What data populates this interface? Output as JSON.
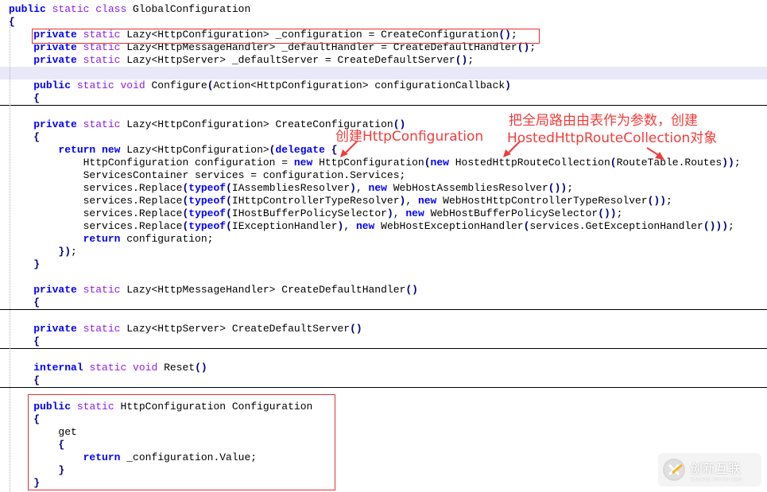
{
  "code": {
    "lines": [
      {
        "indent": "",
        "tokens": [
          {
            "t": "kb",
            "v": "public"
          },
          {
            "t": "",
            "v": " "
          },
          {
            "t": "kp",
            "v": "static class"
          },
          {
            "t": "",
            "v": " GlobalConfiguration"
          }
        ]
      },
      {
        "indent": "",
        "tokens": [
          {
            "t": "pn",
            "v": "{"
          }
        ]
      },
      {
        "indent": "    ",
        "tokens": [
          {
            "t": "kb",
            "v": "private"
          },
          {
            "t": "",
            "v": " "
          },
          {
            "t": "kp",
            "v": "static"
          },
          {
            "t": "",
            "v": " Lazy<HttpConfiguration> _configuration = CreateConfiguration"
          },
          {
            "t": "pn",
            "v": "()"
          },
          {
            "t": "",
            "v": ";"
          }
        ]
      },
      {
        "indent": "    ",
        "tokens": [
          {
            "t": "kb",
            "v": "private"
          },
          {
            "t": "",
            "v": " "
          },
          {
            "t": "kp",
            "v": "static"
          },
          {
            "t": "",
            "v": " Lazy<HttpMessageHandler> _defaultHandler = CreateDefaultHandler"
          },
          {
            "t": "pn",
            "v": "()"
          },
          {
            "t": "",
            "v": ";"
          }
        ]
      },
      {
        "indent": "    ",
        "tokens": [
          {
            "t": "kb",
            "v": "private"
          },
          {
            "t": "",
            "v": " "
          },
          {
            "t": "kp",
            "v": "static"
          },
          {
            "t": "",
            "v": " Lazy<HttpServer> _defaultServer = CreateDefaultServer"
          },
          {
            "t": "pn",
            "v": "()"
          },
          {
            "t": "",
            "v": ";"
          }
        ]
      },
      {
        "indent": "",
        "tokens": [],
        "hl": true
      },
      {
        "indent": "    ",
        "tokens": [
          {
            "t": "kb",
            "v": "public"
          },
          {
            "t": "",
            "v": " "
          },
          {
            "t": "kp",
            "v": "static void"
          },
          {
            "t": "",
            "v": " Configure"
          },
          {
            "t": "pn",
            "v": "("
          },
          {
            "t": "",
            "v": "Action<HttpConfiguration> configurationCallback"
          },
          {
            "t": "pn",
            "v": ")"
          }
        ]
      },
      {
        "indent": "    ",
        "tokens": [
          {
            "t": "pn",
            "v": "{"
          }
        ],
        "sep": true
      },
      {
        "indent": "",
        "tokens": []
      },
      {
        "indent": "    ",
        "tokens": [
          {
            "t": "kb",
            "v": "private"
          },
          {
            "t": "",
            "v": " "
          },
          {
            "t": "kp",
            "v": "static"
          },
          {
            "t": "",
            "v": " Lazy<HttpConfiguration> CreateConfiguration"
          },
          {
            "t": "pn",
            "v": "()"
          }
        ]
      },
      {
        "indent": "    ",
        "tokens": [
          {
            "t": "pn",
            "v": "{"
          }
        ]
      },
      {
        "indent": "        ",
        "tokens": [
          {
            "t": "kb",
            "v": "return new"
          },
          {
            "t": "",
            "v": " Lazy<HttpConfiguration>"
          },
          {
            "t": "pn",
            "v": "("
          },
          {
            "t": "kb",
            "v": "delegate"
          },
          {
            "t": "",
            "v": " "
          },
          {
            "t": "pn",
            "v": "{"
          }
        ]
      },
      {
        "indent": "            ",
        "tokens": [
          {
            "t": "",
            "v": "HttpConfiguration configuration = "
          },
          {
            "t": "kb",
            "v": "new"
          },
          {
            "t": "",
            "v": " HttpConfiguration"
          },
          {
            "t": "pn",
            "v": "("
          },
          {
            "t": "kb",
            "v": "new"
          },
          {
            "t": "",
            "v": " HostedHttpRouteCollection"
          },
          {
            "t": "pn",
            "v": "("
          },
          {
            "t": "",
            "v": "RouteTable.Routes"
          },
          {
            "t": "pn",
            "v": "))"
          },
          {
            "t": "",
            "v": ";"
          }
        ]
      },
      {
        "indent": "            ",
        "tokens": [
          {
            "t": "",
            "v": "ServicesContainer services = configuration.Services;"
          }
        ]
      },
      {
        "indent": "            ",
        "tokens": [
          {
            "t": "",
            "v": "services.Replace"
          },
          {
            "t": "pn",
            "v": "("
          },
          {
            "t": "kb",
            "v": "typeof"
          },
          {
            "t": "pn",
            "v": "("
          },
          {
            "t": "",
            "v": "IAssembliesResolver"
          },
          {
            "t": "pn",
            "v": ")"
          },
          {
            "t": "",
            "v": ", "
          },
          {
            "t": "kb",
            "v": "new"
          },
          {
            "t": "",
            "v": " WebHostAssembliesResolver"
          },
          {
            "t": "pn",
            "v": "())"
          },
          {
            "t": "",
            "v": ";"
          }
        ]
      },
      {
        "indent": "            ",
        "tokens": [
          {
            "t": "",
            "v": "services.Replace"
          },
          {
            "t": "pn",
            "v": "("
          },
          {
            "t": "kb",
            "v": "typeof"
          },
          {
            "t": "pn",
            "v": "("
          },
          {
            "t": "",
            "v": "IHttpControllerTypeResolver"
          },
          {
            "t": "pn",
            "v": ")"
          },
          {
            "t": "",
            "v": ", "
          },
          {
            "t": "kb",
            "v": "new"
          },
          {
            "t": "",
            "v": " WebHostHttpControllerTypeResolver"
          },
          {
            "t": "pn",
            "v": "())"
          },
          {
            "t": "",
            "v": ";"
          }
        ]
      },
      {
        "indent": "            ",
        "tokens": [
          {
            "t": "",
            "v": "services.Replace"
          },
          {
            "t": "pn",
            "v": "("
          },
          {
            "t": "kb",
            "v": "typeof"
          },
          {
            "t": "pn",
            "v": "("
          },
          {
            "t": "",
            "v": "IHostBufferPolicySelector"
          },
          {
            "t": "pn",
            "v": ")"
          },
          {
            "t": "",
            "v": ", "
          },
          {
            "t": "kb",
            "v": "new"
          },
          {
            "t": "",
            "v": " WebHostBufferPolicySelector"
          },
          {
            "t": "pn",
            "v": "())"
          },
          {
            "t": "",
            "v": ";"
          }
        ]
      },
      {
        "indent": "            ",
        "tokens": [
          {
            "t": "",
            "v": "services.Replace"
          },
          {
            "t": "pn",
            "v": "("
          },
          {
            "t": "kb",
            "v": "typeof"
          },
          {
            "t": "pn",
            "v": "("
          },
          {
            "t": "",
            "v": "IExceptionHandler"
          },
          {
            "t": "pn",
            "v": ")"
          },
          {
            "t": "",
            "v": ", "
          },
          {
            "t": "kb",
            "v": "new"
          },
          {
            "t": "",
            "v": " WebHostExceptionHandler"
          },
          {
            "t": "pn",
            "v": "("
          },
          {
            "t": "",
            "v": "services.GetExceptionHandler"
          },
          {
            "t": "pn",
            "v": "()))"
          },
          {
            "t": "",
            "v": ";"
          }
        ]
      },
      {
        "indent": "            ",
        "tokens": [
          {
            "t": "kb",
            "v": "return"
          },
          {
            "t": "",
            "v": " configuration;"
          }
        ]
      },
      {
        "indent": "        ",
        "tokens": [
          {
            "t": "pn",
            "v": "})"
          },
          {
            "t": "",
            "v": ";"
          }
        ]
      },
      {
        "indent": "    ",
        "tokens": [
          {
            "t": "pn",
            "v": "}"
          }
        ]
      },
      {
        "indent": "",
        "tokens": []
      },
      {
        "indent": "    ",
        "tokens": [
          {
            "t": "kb",
            "v": "private"
          },
          {
            "t": "",
            "v": " "
          },
          {
            "t": "kp",
            "v": "static"
          },
          {
            "t": "",
            "v": " Lazy<HttpMessageHandler> CreateDefaultHandler"
          },
          {
            "t": "pn",
            "v": "()"
          }
        ]
      },
      {
        "indent": "    ",
        "tokens": [
          {
            "t": "pn",
            "v": "{"
          }
        ],
        "sep": true
      },
      {
        "indent": "",
        "tokens": []
      },
      {
        "indent": "    ",
        "tokens": [
          {
            "t": "kb",
            "v": "private"
          },
          {
            "t": "",
            "v": " "
          },
          {
            "t": "kp",
            "v": "static"
          },
          {
            "t": "",
            "v": " Lazy<HttpServer> CreateDefaultServer"
          },
          {
            "t": "pn",
            "v": "()"
          }
        ]
      },
      {
        "indent": "    ",
        "tokens": [
          {
            "t": "pn",
            "v": "{"
          }
        ],
        "sep": true
      },
      {
        "indent": "",
        "tokens": []
      },
      {
        "indent": "    ",
        "tokens": [
          {
            "t": "kb",
            "v": "internal"
          },
          {
            "t": "",
            "v": " "
          },
          {
            "t": "kp",
            "v": "static void"
          },
          {
            "t": "",
            "v": " Reset"
          },
          {
            "t": "pn",
            "v": "()"
          }
        ]
      },
      {
        "indent": "    ",
        "tokens": [
          {
            "t": "pn",
            "v": "{"
          }
        ],
        "sep": true
      },
      {
        "indent": "",
        "tokens": []
      },
      {
        "indent": "    ",
        "tokens": [
          {
            "t": "kb",
            "v": "public"
          },
          {
            "t": "",
            "v": " "
          },
          {
            "t": "kp",
            "v": "static"
          },
          {
            "t": "",
            "v": " HttpConfiguration Configuration"
          }
        ]
      },
      {
        "indent": "    ",
        "tokens": [
          {
            "t": "pn",
            "v": "{"
          }
        ]
      },
      {
        "indent": "        ",
        "tokens": [
          {
            "t": "",
            "v": "get"
          }
        ]
      },
      {
        "indent": "        ",
        "tokens": [
          {
            "t": "pn",
            "v": "{"
          }
        ]
      },
      {
        "indent": "            ",
        "tokens": [
          {
            "t": "kb",
            "v": "return"
          },
          {
            "t": "",
            "v": " _configuration.Value;"
          }
        ]
      },
      {
        "indent": "        ",
        "tokens": [
          {
            "t": "pn",
            "v": "}"
          }
        ]
      },
      {
        "indent": "    ",
        "tokens": [
          {
            "t": "pn",
            "v": "}"
          }
        ]
      }
    ]
  },
  "annotations": {
    "create_http_configuration": "创建HttpConfiguration",
    "route_param_line1": "把全局路由由表作为参数，创建",
    "route_param_line2": "HostedHttpRouteCollection对象"
  },
  "watermark": {
    "name_cn": "创新互联",
    "name_en": "CHUANG XIN HU LIAN"
  },
  "colors": {
    "keyword_blue": "#0000ff",
    "keyword_purple": "#8b1ee8",
    "annotation_red": "#f03c3c",
    "highlight_line": "#e8e8f8"
  }
}
